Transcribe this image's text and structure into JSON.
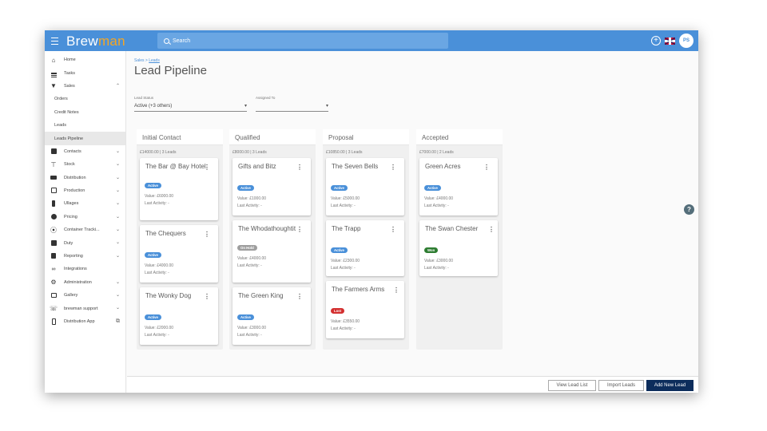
{
  "app": {
    "logo_part1": "Brew",
    "logo_part2": "man"
  },
  "search": {
    "label": "Search"
  },
  "topbar": {
    "avatar_initials": "PS",
    "plus_symbol": "+"
  },
  "sidebar": {
    "items": [
      {
        "label": "Home",
        "icon": "home-icon"
      },
      {
        "label": "Tasks",
        "icon": "list-icon"
      },
      {
        "label": "Sales",
        "icon": "basket-icon",
        "expanded": true
      },
      {
        "label": "Orders"
      },
      {
        "label": "Credit Notes"
      },
      {
        "label": "Leads"
      },
      {
        "label": "Leads Pipeline",
        "active": true
      },
      {
        "label": "Contacts",
        "icon": "contacts-icon"
      },
      {
        "label": "Stock",
        "icon": "stock-icon"
      },
      {
        "label": "Distribution",
        "icon": "truck-icon"
      },
      {
        "label": "Production",
        "icon": "production-icon"
      },
      {
        "label": "Ullages",
        "icon": "bottle-icon"
      },
      {
        "label": "Pricing",
        "icon": "pricing-icon"
      },
      {
        "label": "Container Tracki...",
        "icon": "container-icon"
      },
      {
        "label": "Duty",
        "icon": "duty-icon"
      },
      {
        "label": "Reporting",
        "icon": "reporting-icon"
      },
      {
        "label": "Integrations",
        "icon": "link-icon"
      },
      {
        "label": "Administration",
        "icon": "gear-icon"
      },
      {
        "label": "Gallery",
        "icon": "gallery-icon"
      },
      {
        "label": "brewman support",
        "icon": "support-icon"
      },
      {
        "label": "Distribution App",
        "icon": "phone-icon"
      }
    ]
  },
  "main": {
    "breadcrumb_root": "Sales",
    "breadcrumb_sep": " > ",
    "breadcrumb_current": "Leads",
    "title": "Lead Pipeline",
    "filters": [
      {
        "label": "Lead Status",
        "value": "Active (+3 others)"
      },
      {
        "label": "Assigned To",
        "value": ""
      }
    ]
  },
  "pipeline": [
    {
      "name": "Initial Contact",
      "summary": "£14000.00 | 3 Leads",
      "cards": [
        {
          "name": "The Bar @ Bay Hotel",
          "status": "Active",
          "value": "Value: £6000.00",
          "activity": "Last Activity: -"
        },
        {
          "name": "The Chequers",
          "status": "Active",
          "value": "Value: £4000.00",
          "activity": "Last Activity: -"
        },
        {
          "name": "The Wonky Dog",
          "status": "Active",
          "value": "Value: £2000.00",
          "activity": "Last Activity: -"
        }
      ]
    },
    {
      "name": "Qualified",
      "summary": "£8000.00 | 3 Leads",
      "cards": [
        {
          "name": "Gifts and Bitz",
          "status": "Active",
          "value": "Value: £1000.00",
          "activity": "Last Activity: -"
        },
        {
          "name": "The Whodathoughtit",
          "status": "On Hold",
          "value": "Value: £4000.00",
          "activity": "Last Activity: -"
        },
        {
          "name": "The Green King",
          "status": "Active",
          "value": "Value: £3000.00",
          "activity": "Last Activity: -"
        }
      ]
    },
    {
      "name": "Proposal",
      "summary": "£10850.00 | 3 Leads",
      "cards": [
        {
          "name": "The Seven Bells",
          "status": "Active",
          "value": "Value: £5000.00",
          "activity": "Last Activity: -"
        },
        {
          "name": "The Trapp",
          "status": "Active",
          "value": "Value: £2300.00",
          "activity": "Last Activity: -"
        },
        {
          "name": "The Farmers Arms",
          "status": "Lost",
          "value": "Value: £3550.00",
          "activity": "Last Activity: -"
        }
      ]
    },
    {
      "name": "Accepted",
      "summary": "£7000.00 | 2 Leads",
      "cards": [
        {
          "name": "Green Acres",
          "status": "Active",
          "value": "Value: £4000.00",
          "activity": "Last Activity: -"
        },
        {
          "name": "The Swan Chester",
          "status": "Won",
          "value": "Value: £3000.00",
          "activity": "Last Activity: -"
        }
      ]
    }
  ],
  "footer": {
    "view_list": "View Lead List",
    "import": "Import Leads",
    "add_new": "Add New Lead"
  },
  "help": {
    "symbol": "?"
  },
  "colors": {
    "topbar": "#4a90d9",
    "accent_logo": "#f5a623",
    "primary_button": "#0d2d5c",
    "status_active": "#4a90d9",
    "status_hold": "#9e9e9e",
    "status_lost": "#d32f2f",
    "status_won": "#2e7d32"
  }
}
